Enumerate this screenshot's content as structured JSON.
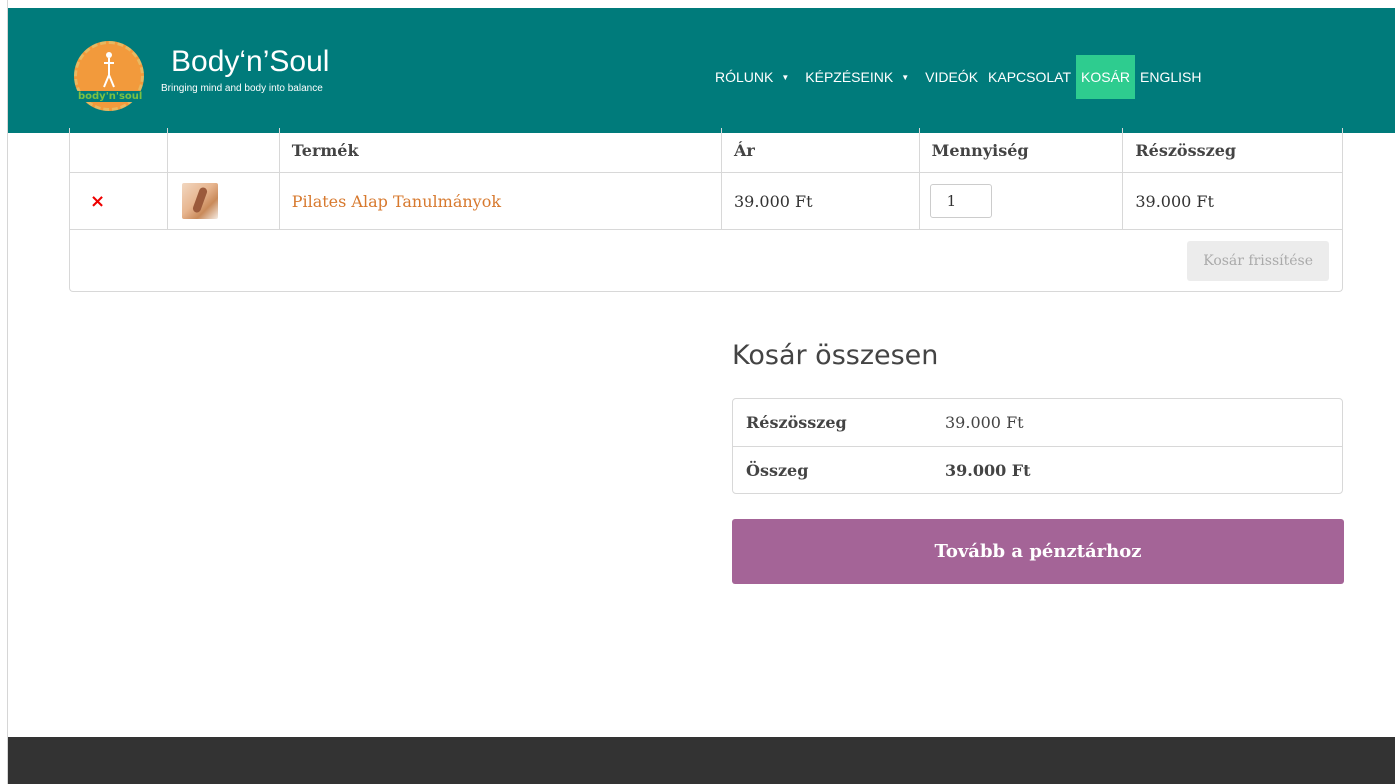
{
  "brand": {
    "logo_text": "body'n'soul",
    "name": "Body‘n’Soul",
    "tagline": "Bringing mind and body into balance"
  },
  "nav": {
    "items": [
      {
        "label": "RÓLUNK",
        "has_dropdown": true
      },
      {
        "label": "KÉPZÉSEINK",
        "has_dropdown": true
      },
      {
        "label": "VIDEÓK",
        "has_dropdown": false
      },
      {
        "label": "KAPCSOLAT",
        "has_dropdown": false
      },
      {
        "label": "KOSÁR",
        "has_dropdown": false,
        "active": true
      },
      {
        "label": "ENGLISH",
        "has_dropdown": false
      }
    ],
    "caret": "▼"
  },
  "cart": {
    "headers": [
      "",
      "",
      "Termék",
      "Ár",
      "Mennyiség",
      "Részösszeg"
    ],
    "items": [
      {
        "remove_symbol": "×",
        "product": "Pilates Alap Tanulmányok",
        "price": "39.000 Ft",
        "quantity": "1",
        "subtotal": "39.000 Ft"
      }
    ],
    "update_label": "Kosár frissítése"
  },
  "totals": {
    "title": "Kosár összesen",
    "subtotal_label": "Részösszeg",
    "subtotal_value": "39.000 Ft",
    "total_label": "Összeg",
    "total_value": "39.000 Ft"
  },
  "checkout": {
    "label": "Tovább a pénztárhoz"
  },
  "colors": {
    "header_bg": "#007b7b",
    "active_nav": "#2ecc8f",
    "checkout_bg": "#a46497",
    "product_link": "#d7792e",
    "remove": "#ee0000",
    "footer_bg": "#333333"
  }
}
